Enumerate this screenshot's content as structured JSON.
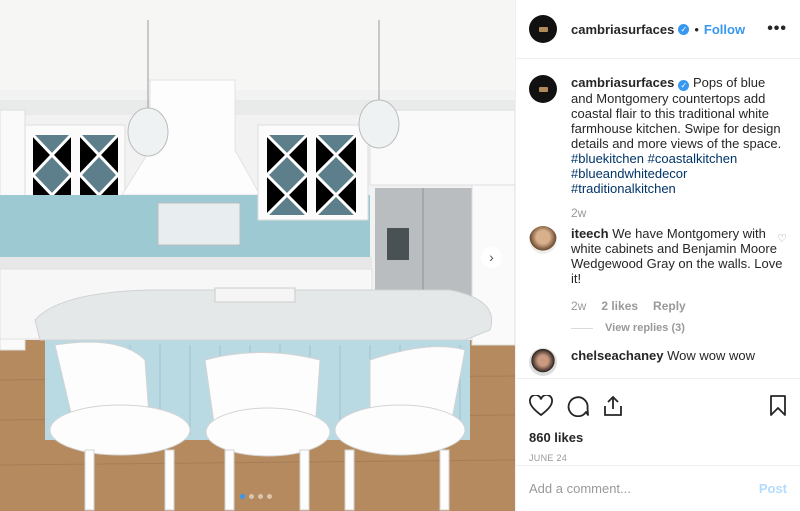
{
  "post": {
    "username": "cambriasurfaces",
    "follow_label": "Follow",
    "separator": "•",
    "more_label": "•••",
    "caption": "Pops of blue and Montgomery countertops add coastal flair to this traditional white farmhouse kitchen. Swipe for design details and more views of the space.",
    "hashtags": [
      "#bluekitchen",
      "#coastalkitchen",
      "#blueandwhitedecor",
      "#traditionalkitchen"
    ],
    "caption_time": "2w",
    "likes": "860 likes",
    "date": "JUNE 24",
    "carousel": {
      "slides": 4,
      "active": 1
    }
  },
  "comments": [
    {
      "username": "iteech",
      "text": "We have Montgomery with white cabinets and Benjamin Moore Wedgewood Gray on the walls. Love it!",
      "time": "2w",
      "likes": "2 likes",
      "reply": "Reply",
      "view_replies": "View replies (3)"
    },
    {
      "username": "chelseachaney",
      "text": "Wow wow wow"
    }
  ],
  "add_comment": {
    "placeholder": "Add a comment...",
    "post_label": "Post"
  },
  "colors": {
    "accent": "#3897f0",
    "hashtag": "#003569",
    "island": "#b9d9e3",
    "backsplash": "#9cc9d2"
  }
}
